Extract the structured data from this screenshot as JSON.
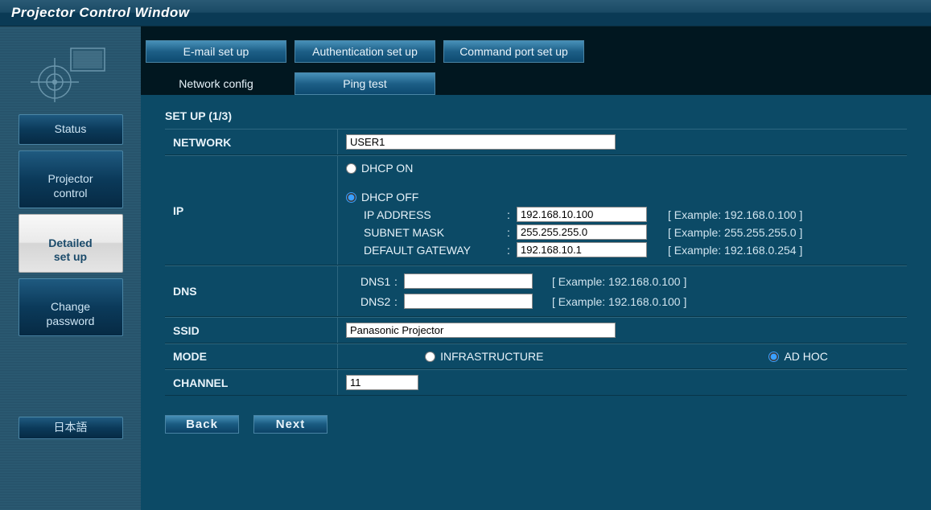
{
  "title": "Projector Control Window",
  "sidebar": {
    "items": [
      {
        "label": "Status"
      },
      {
        "label": "Projector\ncontrol"
      },
      {
        "label": "Detailed\nset up"
      },
      {
        "label": "Change\npassword"
      }
    ],
    "lang": "日本語"
  },
  "tabs": {
    "row1": [
      {
        "label": "E-mail set up"
      },
      {
        "label": "Authentication set up"
      },
      {
        "label": "Command port set up"
      }
    ],
    "row2": [
      {
        "label": "Network config"
      },
      {
        "label": "Ping test"
      }
    ]
  },
  "form": {
    "section_title": "SET UP (1/3)",
    "network": {
      "label": "NETWORK",
      "value": "USER1"
    },
    "ip": {
      "label": "IP",
      "dhcp_on": "DHCP ON",
      "dhcp_off": "DHCP OFF",
      "ip_address": {
        "label": "IP ADDRESS",
        "value": "192.168.10.100",
        "example": "[ Example: 192.168.0.100 ]"
      },
      "subnet": {
        "label": "SUBNET MASK",
        "value": "255.255.255.0",
        "example": "[ Example: 255.255.255.0 ]"
      },
      "gateway": {
        "label": "DEFAULT GATEWAY",
        "value": "192.168.10.1",
        "example": "[ Example: 192.168.0.254 ]"
      }
    },
    "dns": {
      "label": "DNS",
      "dns1": {
        "label": "DNS1",
        "value": "",
        "example": "[ Example: 192.168.0.100 ]"
      },
      "dns2": {
        "label": "DNS2",
        "value": "",
        "example": "[ Example: 192.168.0.100 ]"
      }
    },
    "ssid": {
      "label": "SSID",
      "value": "Panasonic Projector"
    },
    "mode": {
      "label": "MODE",
      "infrastructure": "INFRASTRUCTURE",
      "adhoc": "AD HOC"
    },
    "channel": {
      "label": "CHANNEL",
      "value": "11"
    }
  },
  "buttons": {
    "back": "Back",
    "next": "Next"
  },
  "colon": ":"
}
